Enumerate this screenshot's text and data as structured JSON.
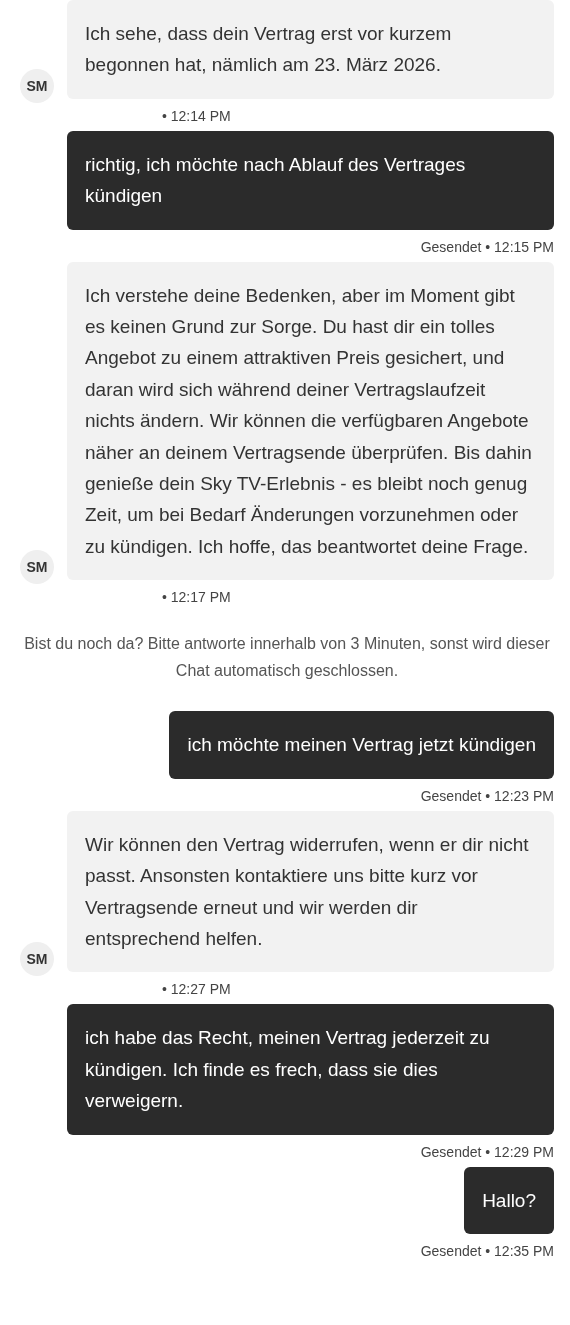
{
  "messages": [
    {
      "kind": "agent",
      "avatar": "SM",
      "text": "Ich sehe, dass dein Vertrag erst vor kurzem begonnen hat, nämlich am 23. März 2026.",
      "meta": "• 12:14 PM"
    },
    {
      "kind": "user",
      "text": "richtig, ich möchte nach Ablauf des Vertrages kündigen",
      "meta": "Gesendet • 12:15 PM"
    },
    {
      "kind": "agent",
      "avatar": "SM",
      "text": "Ich verstehe deine Bedenken, aber im Moment gibt es keinen Grund zur Sorge. Du hast dir ein tolles Angebot zu einem attraktiven Preis gesichert, und daran wird sich während deiner Vertragslaufzeit nichts ändern. Wir können die verfügbaren Angebote näher an deinem Vertragsende überprüfen. Bis dahin genieße dein Sky TV-Erlebnis - es bleibt noch genug Zeit, um bei Bedarf Änderungen vorzunehmen oder zu kündigen. Ich hoffe, das beantwortet deine Frage.",
      "meta": "• 12:17 PM"
    },
    {
      "kind": "system",
      "text": "Bist du noch da? Bitte antworte innerhalb von 3 Minuten, sonst wird dieser Chat automatisch geschlossen."
    },
    {
      "kind": "user",
      "text": "ich möchte meinen Vertrag jetzt kündigen",
      "meta": "Gesendet • 12:23 PM"
    },
    {
      "kind": "agent",
      "avatar": "SM",
      "text": "Wir können den Vertrag widerrufen, wenn er dir nicht passt. Ansonsten kontaktiere uns bitte kurz vor Vertragsende erneut und wir werden dir entsprechend helfen.",
      "meta": "• 12:27 PM"
    },
    {
      "kind": "user",
      "text": "ich habe das Recht, meinen Vertrag jederzeit zu kündigen. Ich finde es frech, dass sie dies verweigern.",
      "meta": "Gesendet • 12:29 PM"
    },
    {
      "kind": "user",
      "text": "Hallo?",
      "meta": "Gesendet • 12:35 PM"
    }
  ]
}
